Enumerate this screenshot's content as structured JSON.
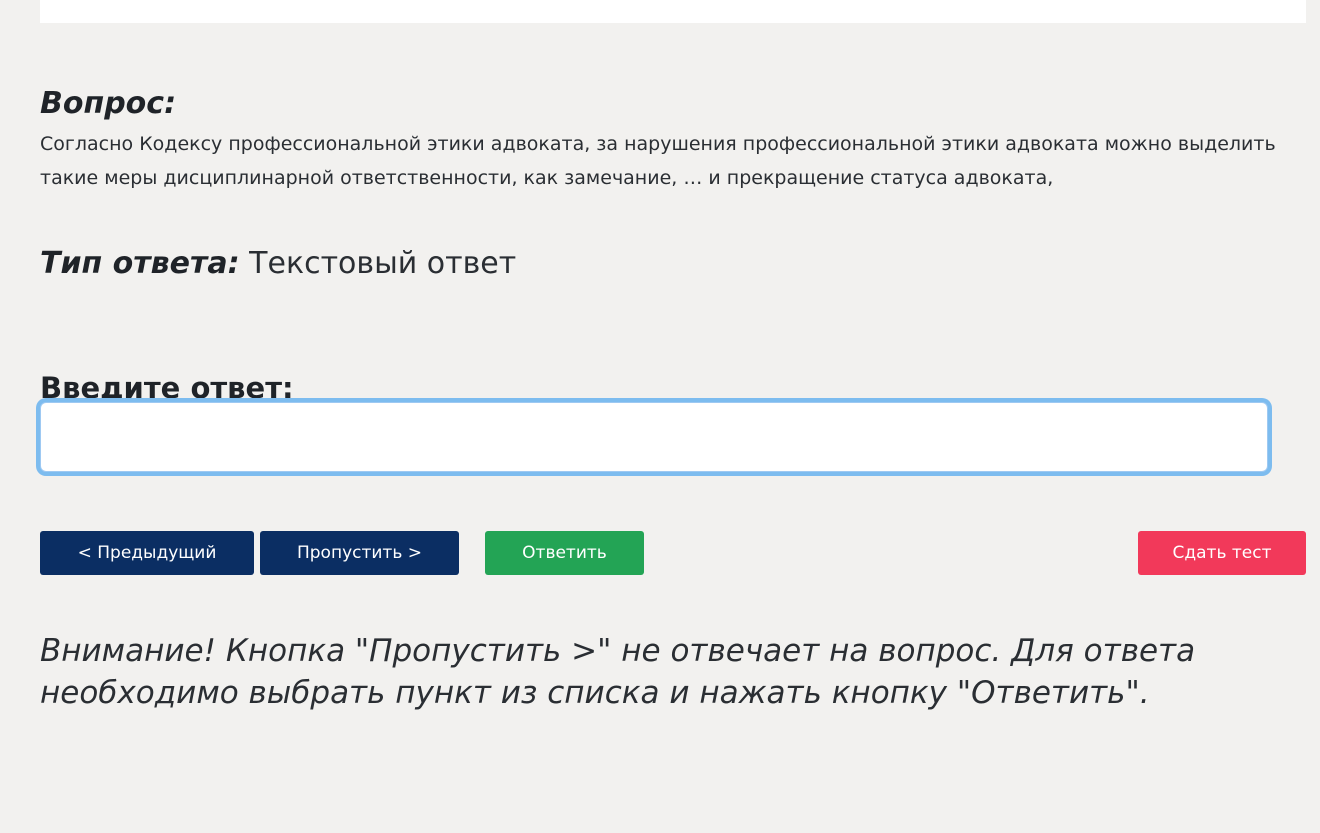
{
  "question": {
    "label": "Вопрос:",
    "text": "Согласно Кодексу профессиональной этики адвоката, за нарушения профессиональной этики адвоката можно выделить такие меры дисциплинарной ответственности, как замечание, … и прекращение статуса адвоката,"
  },
  "answer_type": {
    "label": "Тип ответа:",
    "value": "Текстовый ответ"
  },
  "answer_input": {
    "label": "Введите ответ:",
    "value": "",
    "placeholder": ""
  },
  "buttons": {
    "previous": "< Предыдущий",
    "skip": "Пропустить >",
    "answer": "Ответить",
    "submit_test": "Сдать тест"
  },
  "colors": {
    "nav_button": "#0b2e63",
    "answer_button": "#23a455",
    "submit_button": "#f2395a",
    "input_focus_ring": "#7dbcef",
    "page_background": "#f2f1ef"
  },
  "warning": "Внимание! Кнопка \"Пропустить >\" не отвечает на вопрос. Для ответа необходимо выбрать пункт из списка и нажать кнопку \"Ответить\"."
}
